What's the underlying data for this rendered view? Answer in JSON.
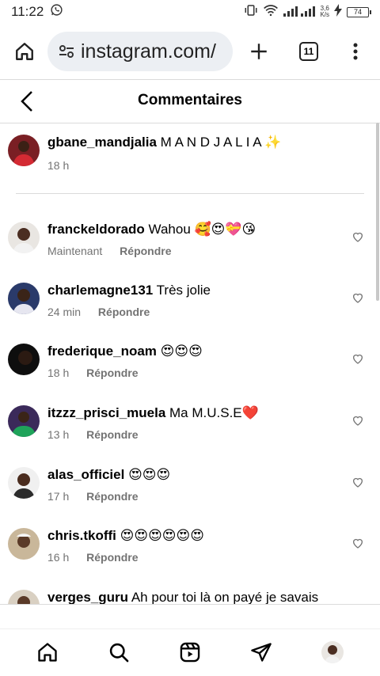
{
  "status_bar": {
    "time": "11:22",
    "speed_top": "3,6",
    "speed_bottom": "K/s",
    "battery": "74"
  },
  "browser": {
    "url": "instagram.com/",
    "tab_count": "11"
  },
  "header": {
    "title": "Commentaires"
  },
  "caption": {
    "username": "gbane_mandjalia",
    "text": "M A N D J A L I A ✨",
    "time": "18 h"
  },
  "reply_label": "Répondre",
  "comments": [
    {
      "username": "franckeldorado",
      "text": "Wahou 🥰😍💝😘",
      "time": "Maintenant"
    },
    {
      "username": "charlemagne131",
      "text": "Très jolie",
      "time": "24 min"
    },
    {
      "username": "frederique_noam",
      "text": "😍😍😍",
      "time": "18 h"
    },
    {
      "username": "itzzz_prisci_muela",
      "text": "Ma M.U.S.E❤️",
      "time": "13 h"
    },
    {
      "username": "alas_officiel",
      "text": "😍😍😍",
      "time": "17 h"
    },
    {
      "username": "chris.tkoffi",
      "text": "😍😍😍😍😍😍",
      "time": "16 h"
    },
    {
      "username": "verges_guru",
      "text": "Ah pour toi là on payé je savais",
      "time": ""
    }
  ],
  "colors": {
    "accent": "#000000",
    "meta": "#737373",
    "divider": "#dbdbdb",
    "url_pill": "#eceff3"
  }
}
